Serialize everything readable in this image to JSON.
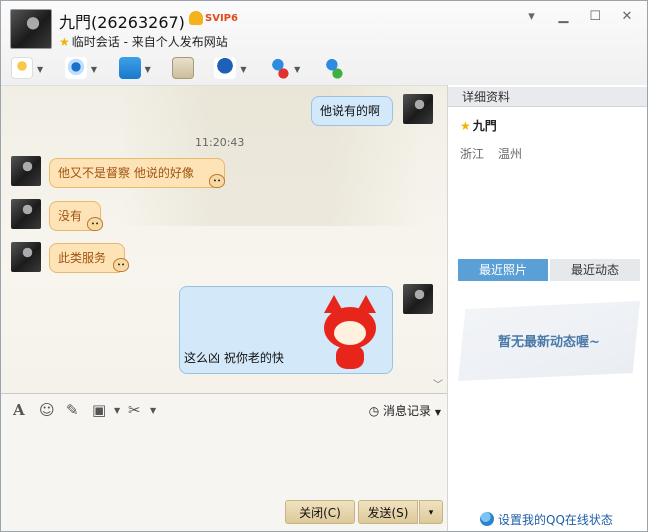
{
  "header": {
    "contact_name": "九門(26263267)",
    "vip_badge": "SVIP6",
    "session_info": "临时会话 - 来自个人发布网站",
    "window_controls": [
      "chevron-down-icon",
      "minimize-icon",
      "maximize-icon",
      "close-icon"
    ],
    "toolbar_icons": [
      "microphone-icon",
      "webcam-icon",
      "send-file-icon",
      "screen-share-icon",
      "remote-assist-icon",
      "block-user-icon",
      "add-friend-icon"
    ]
  },
  "chat": {
    "messages": [
      {
        "side": "right",
        "text": "他说有的啊"
      },
      {
        "side": "left",
        "text": "他又不是督察 他说的好像"
      },
      {
        "side": "left",
        "text": "没有"
      },
      {
        "side": "left",
        "text": "此类服务"
      },
      {
        "side": "right",
        "text": "这么凶   祝你老的快"
      }
    ],
    "timestamp": "11:20:43"
  },
  "input_toolbar": {
    "icons": [
      "font-icon",
      "emoji-icon",
      "edit-image-icon",
      "image-icon",
      "scissors-icon"
    ],
    "history_label": "消息记录"
  },
  "buttons": {
    "close_label": "关闭(C)",
    "send_label": "发送(S)",
    "send_options": "▾"
  },
  "panel": {
    "header": "详细资料",
    "name": "九門",
    "province": "浙江",
    "city": "温州",
    "tabs": [
      "最近照片",
      "最近动态"
    ],
    "empty_feed": "暂无最新动态喔~",
    "status_link": "设置我的QQ在线状态"
  },
  "colors": {
    "left_bubble": "#fde3b5",
    "right_bubble": "#d3e8f9",
    "active_tab": "#5aa0d6",
    "link": "#1e5fa5"
  }
}
